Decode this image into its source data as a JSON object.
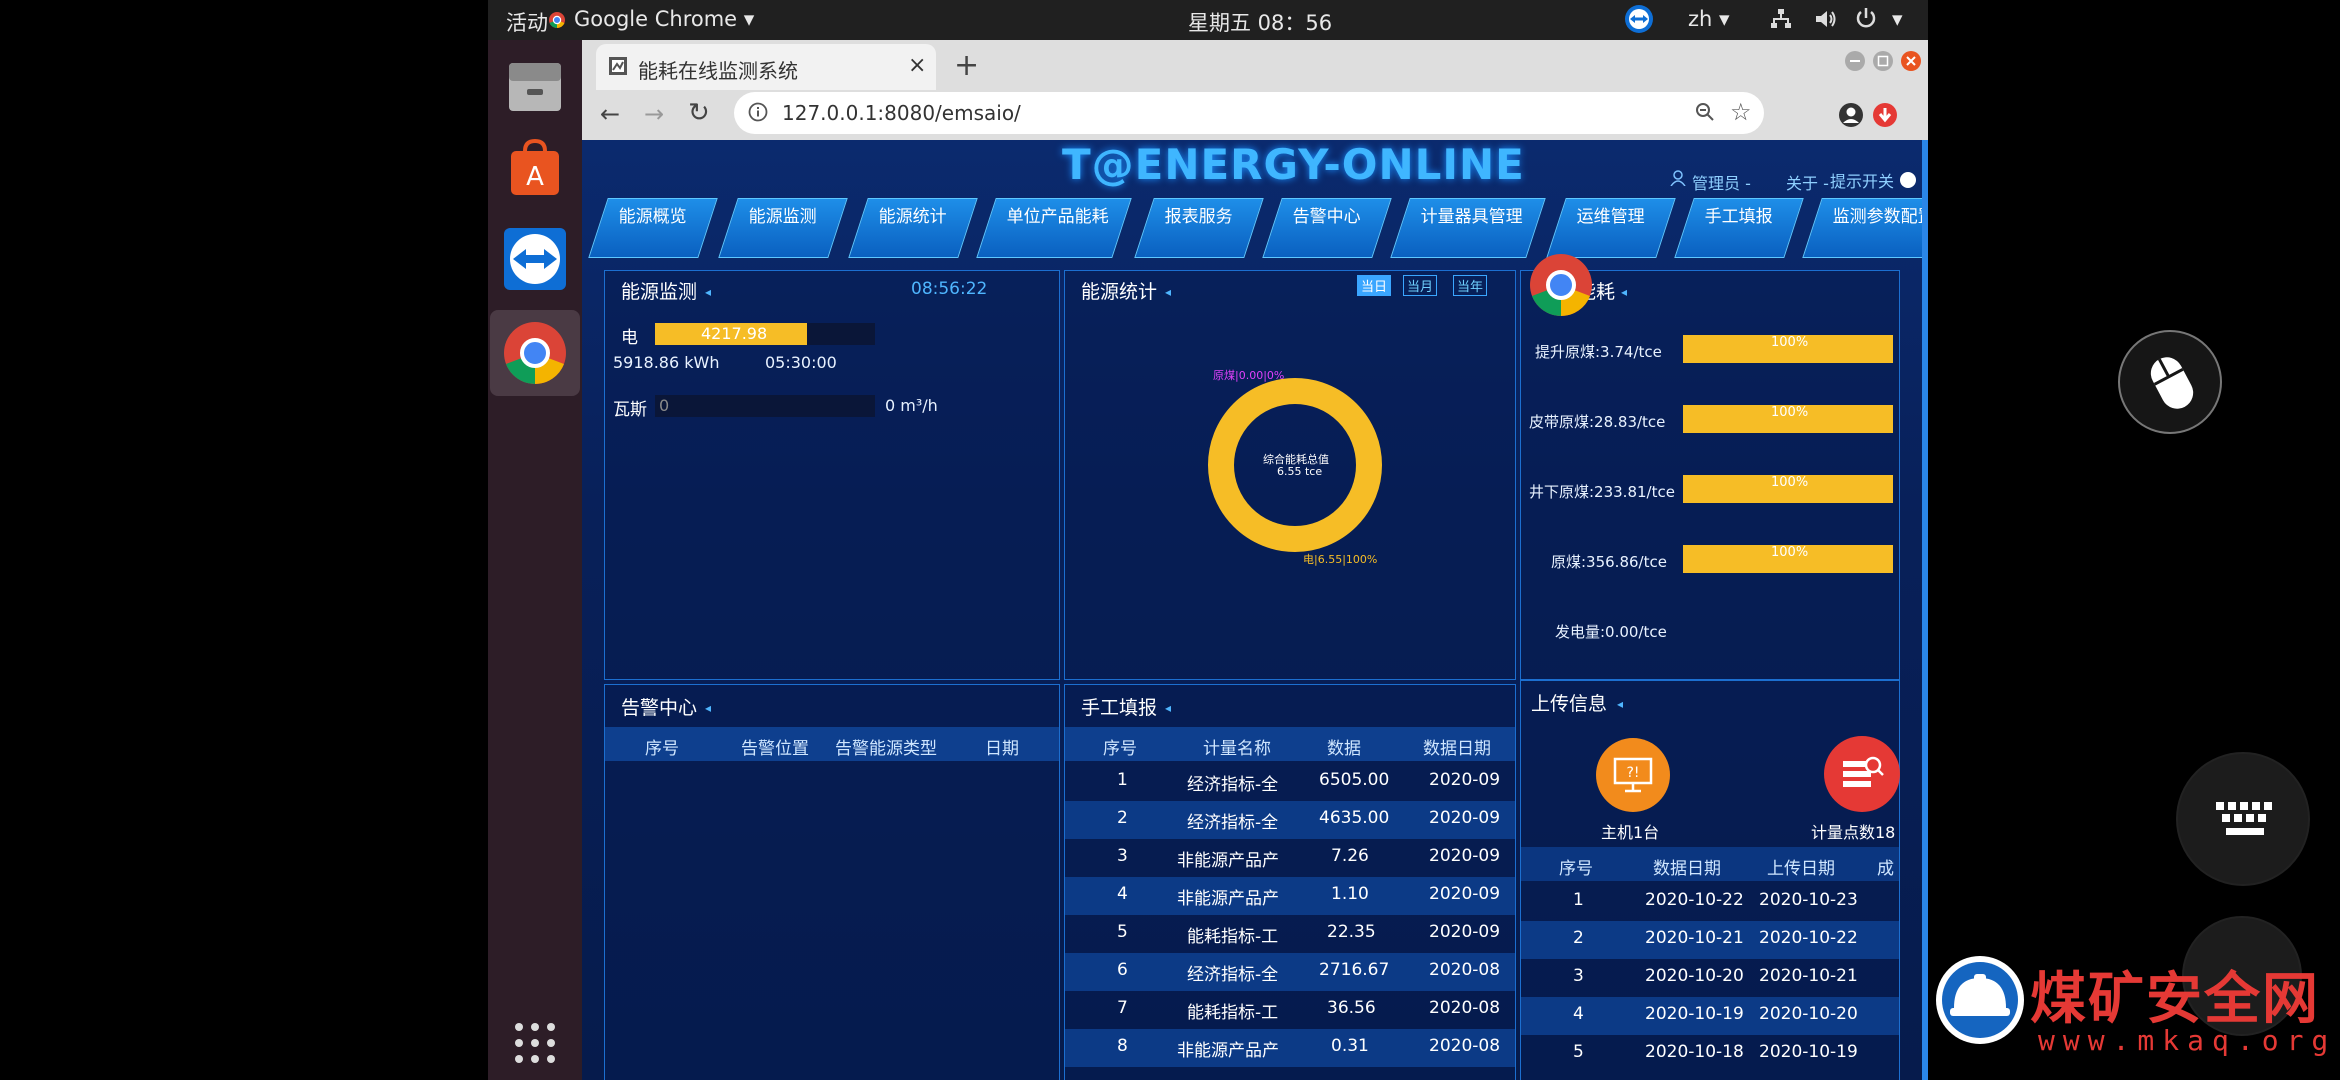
{
  "topbar": {
    "activities": "活动",
    "app_name": "Google Chrome",
    "clock": "星期五 08：56",
    "lang": "zh"
  },
  "browser": {
    "tab_title": "能耗在线监测系统",
    "url": "127.0.0.1:8080/emsaio/"
  },
  "site": {
    "logo": "T@ENERGY-ONLINE",
    "admin": "管理员 -",
    "about": "关于 -",
    "hint": "提示开关",
    "nav": [
      "能源概览",
      "能源监测",
      "能源统计",
      "单位产品能耗",
      "报表服务",
      "告警中心",
      "计量器具管理",
      "运维管理",
      "手工填报",
      "监测参数配置"
    ]
  },
  "monitor": {
    "title": "能源监测",
    "time": "08:56:22",
    "elec_label": "电",
    "elec_value": "4217.98",
    "elec_total": "5918.86 kWh",
    "elec_time": "05:30:00",
    "gas_label": "瓦斯",
    "gas_value": "0",
    "gas_unit": "0 m³/h"
  },
  "stats": {
    "title": "能源统计",
    "tabs": [
      "当日",
      "当月",
      "当年"
    ],
    "center_line1": "综合能耗总值",
    "center_line2": "6.55 tce",
    "label_top": "原煤|0.00|0%",
    "label_bottom": "电|6.55|100%"
  },
  "consumption": {
    "title": "能耗",
    "items": [
      {
        "label": "提升原煤:3.74/tce",
        "pct": "100%"
      },
      {
        "label": "皮带原煤:28.83/tce",
        "pct": "100%"
      },
      {
        "label": "井下原煤:233.81/tce",
        "pct": "100%"
      },
      {
        "label": "原煤:356.86/tce",
        "pct": "100%"
      },
      {
        "label": "发电量:0.00/tce",
        "pct": ""
      }
    ]
  },
  "alarm": {
    "title": "告警中心",
    "cols": [
      "序号",
      "告警位置",
      "告警能源类型",
      "日期"
    ]
  },
  "manual": {
    "title": "手工填报",
    "cols": [
      "序号",
      "计量名称",
      "数据",
      "数据日期"
    ],
    "rows": [
      [
        "1",
        "经济指标-全",
        "6505.00",
        "2020-09"
      ],
      [
        "2",
        "经济指标-全",
        "4635.00",
        "2020-09"
      ],
      [
        "3",
        "非能源产品产",
        "7.26",
        "2020-09"
      ],
      [
        "4",
        "非能源产品产",
        "1.10",
        "2020-09"
      ],
      [
        "5",
        "能耗指标-工",
        "22.35",
        "2020-09"
      ],
      [
        "6",
        "经济指标-全",
        "2716.67",
        "2020-08"
      ],
      [
        "7",
        "能耗指标-工",
        "36.56",
        "2020-08"
      ],
      [
        "8",
        "非能源产品产",
        "0.31",
        "2020-08"
      ]
    ]
  },
  "upload": {
    "title": "上传信息",
    "host": "主机1台",
    "points": "计量点数18",
    "cols": [
      "序号",
      "数据日期",
      "上传日期",
      "成"
    ],
    "rows": [
      [
        "1",
        "2020-10-22",
        "2020-10-23"
      ],
      [
        "2",
        "2020-10-21",
        "2020-10-22"
      ],
      [
        "3",
        "2020-10-20",
        "2020-10-21"
      ],
      [
        "4",
        "2020-10-19",
        "2020-10-20"
      ],
      [
        "5",
        "2020-10-18",
        "2020-10-19"
      ]
    ]
  },
  "watermark": {
    "title": "煤矿安全网",
    "url": "www.mkaq.org"
  }
}
